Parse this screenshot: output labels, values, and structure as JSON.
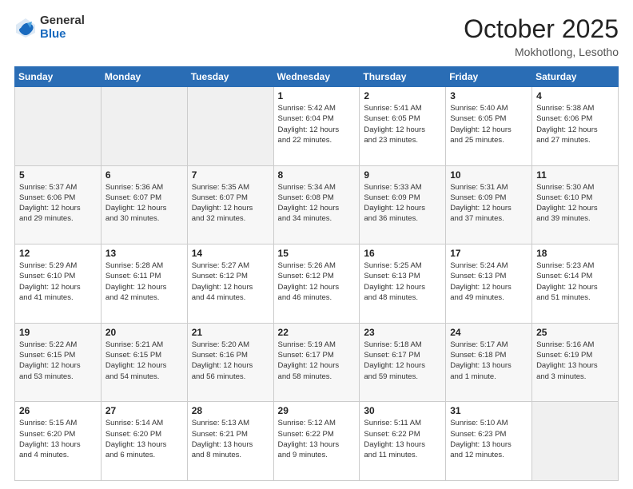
{
  "logo": {
    "general": "General",
    "blue": "Blue"
  },
  "header": {
    "month": "October 2025",
    "location": "Mokhotlong, Lesotho"
  },
  "weekdays": [
    "Sunday",
    "Monday",
    "Tuesday",
    "Wednesday",
    "Thursday",
    "Friday",
    "Saturday"
  ],
  "weeks": [
    [
      {
        "day": "",
        "info": ""
      },
      {
        "day": "",
        "info": ""
      },
      {
        "day": "",
        "info": ""
      },
      {
        "day": "1",
        "info": "Sunrise: 5:42 AM\nSunset: 6:04 PM\nDaylight: 12 hours\nand 22 minutes."
      },
      {
        "day": "2",
        "info": "Sunrise: 5:41 AM\nSunset: 6:05 PM\nDaylight: 12 hours\nand 23 minutes."
      },
      {
        "day": "3",
        "info": "Sunrise: 5:40 AM\nSunset: 6:05 PM\nDaylight: 12 hours\nand 25 minutes."
      },
      {
        "day": "4",
        "info": "Sunrise: 5:38 AM\nSunset: 6:06 PM\nDaylight: 12 hours\nand 27 minutes."
      }
    ],
    [
      {
        "day": "5",
        "info": "Sunrise: 5:37 AM\nSunset: 6:06 PM\nDaylight: 12 hours\nand 29 minutes."
      },
      {
        "day": "6",
        "info": "Sunrise: 5:36 AM\nSunset: 6:07 PM\nDaylight: 12 hours\nand 30 minutes."
      },
      {
        "day": "7",
        "info": "Sunrise: 5:35 AM\nSunset: 6:07 PM\nDaylight: 12 hours\nand 32 minutes."
      },
      {
        "day": "8",
        "info": "Sunrise: 5:34 AM\nSunset: 6:08 PM\nDaylight: 12 hours\nand 34 minutes."
      },
      {
        "day": "9",
        "info": "Sunrise: 5:33 AM\nSunset: 6:09 PM\nDaylight: 12 hours\nand 36 minutes."
      },
      {
        "day": "10",
        "info": "Sunrise: 5:31 AM\nSunset: 6:09 PM\nDaylight: 12 hours\nand 37 minutes."
      },
      {
        "day": "11",
        "info": "Sunrise: 5:30 AM\nSunset: 6:10 PM\nDaylight: 12 hours\nand 39 minutes."
      }
    ],
    [
      {
        "day": "12",
        "info": "Sunrise: 5:29 AM\nSunset: 6:10 PM\nDaylight: 12 hours\nand 41 minutes."
      },
      {
        "day": "13",
        "info": "Sunrise: 5:28 AM\nSunset: 6:11 PM\nDaylight: 12 hours\nand 42 minutes."
      },
      {
        "day": "14",
        "info": "Sunrise: 5:27 AM\nSunset: 6:12 PM\nDaylight: 12 hours\nand 44 minutes."
      },
      {
        "day": "15",
        "info": "Sunrise: 5:26 AM\nSunset: 6:12 PM\nDaylight: 12 hours\nand 46 minutes."
      },
      {
        "day": "16",
        "info": "Sunrise: 5:25 AM\nSunset: 6:13 PM\nDaylight: 12 hours\nand 48 minutes."
      },
      {
        "day": "17",
        "info": "Sunrise: 5:24 AM\nSunset: 6:13 PM\nDaylight: 12 hours\nand 49 minutes."
      },
      {
        "day": "18",
        "info": "Sunrise: 5:23 AM\nSunset: 6:14 PM\nDaylight: 12 hours\nand 51 minutes."
      }
    ],
    [
      {
        "day": "19",
        "info": "Sunrise: 5:22 AM\nSunset: 6:15 PM\nDaylight: 12 hours\nand 53 minutes."
      },
      {
        "day": "20",
        "info": "Sunrise: 5:21 AM\nSunset: 6:15 PM\nDaylight: 12 hours\nand 54 minutes."
      },
      {
        "day": "21",
        "info": "Sunrise: 5:20 AM\nSunset: 6:16 PM\nDaylight: 12 hours\nand 56 minutes."
      },
      {
        "day": "22",
        "info": "Sunrise: 5:19 AM\nSunset: 6:17 PM\nDaylight: 12 hours\nand 58 minutes."
      },
      {
        "day": "23",
        "info": "Sunrise: 5:18 AM\nSunset: 6:17 PM\nDaylight: 12 hours\nand 59 minutes."
      },
      {
        "day": "24",
        "info": "Sunrise: 5:17 AM\nSunset: 6:18 PM\nDaylight: 13 hours\nand 1 minute."
      },
      {
        "day": "25",
        "info": "Sunrise: 5:16 AM\nSunset: 6:19 PM\nDaylight: 13 hours\nand 3 minutes."
      }
    ],
    [
      {
        "day": "26",
        "info": "Sunrise: 5:15 AM\nSunset: 6:20 PM\nDaylight: 13 hours\nand 4 minutes."
      },
      {
        "day": "27",
        "info": "Sunrise: 5:14 AM\nSunset: 6:20 PM\nDaylight: 13 hours\nand 6 minutes."
      },
      {
        "day": "28",
        "info": "Sunrise: 5:13 AM\nSunset: 6:21 PM\nDaylight: 13 hours\nand 8 minutes."
      },
      {
        "day": "29",
        "info": "Sunrise: 5:12 AM\nSunset: 6:22 PM\nDaylight: 13 hours\nand 9 minutes."
      },
      {
        "day": "30",
        "info": "Sunrise: 5:11 AM\nSunset: 6:22 PM\nDaylight: 13 hours\nand 11 minutes."
      },
      {
        "day": "31",
        "info": "Sunrise: 5:10 AM\nSunset: 6:23 PM\nDaylight: 13 hours\nand 12 minutes."
      },
      {
        "day": "",
        "info": ""
      }
    ]
  ]
}
